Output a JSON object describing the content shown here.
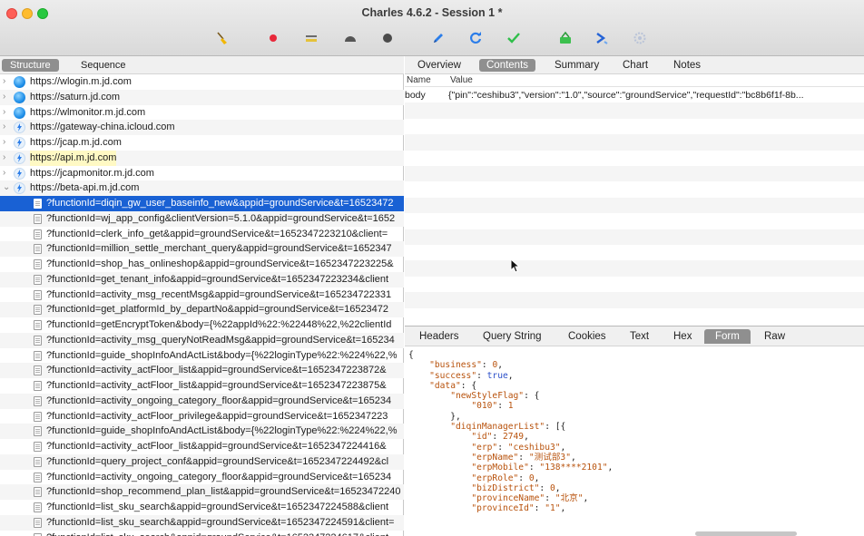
{
  "window": {
    "title": "Charles 4.6.2 - Session 1 *"
  },
  "toolbar": {
    "icons": [
      "broom-icon",
      "record-icon",
      "throttle-icon",
      "breakpoint-icon",
      "stop-icon",
      "pen-icon",
      "refresh-icon",
      "check-icon",
      "basket-icon",
      "tools-icon",
      "settings-icon"
    ]
  },
  "left": {
    "view_tabs": [
      "Structure",
      "Sequence"
    ],
    "hosts": [
      {
        "label": "https://wlogin.m.jd.com",
        "icon": "globe-icon"
      },
      {
        "label": "https://saturn.jd.com",
        "icon": "globe-icon"
      },
      {
        "label": "https://wlmonitor.m.jd.com",
        "icon": "globe-icon"
      },
      {
        "label": "https://gateway-china.icloud.com",
        "icon": "lightning-icon"
      },
      {
        "label": "https://jcap.m.jd.com",
        "icon": "lightning-icon"
      },
      {
        "label": "https://api.m.jd.com",
        "icon": "lightning-icon"
      },
      {
        "label": "https://jcapmonitor.m.jd.com",
        "icon": "lightning-icon"
      },
      {
        "label": "https://beta-api.m.jd.com",
        "icon": "lightning-icon"
      }
    ],
    "requests": [
      "?functionId=diqin_gw_user_baseinfo_new&appid=groundService&t=16523472",
      "?functionId=wj_app_config&clientVersion=5.1.0&appid=groundService&t=1652",
      "?functionId=clerk_info_get&appid=groundService&t=1652347223210&client=",
      "?functionId=million_settle_merchant_query&appid=groundService&t=1652347",
      "?functionId=shop_has_onlineshop&appid=groundService&t=1652347223225&",
      "?functionId=get_tenant_info&appid=groundService&t=1652347223234&client",
      "?functionId=activity_msg_recentMsg&appid=groundService&t=165234722331",
      "?functionId=get_platformId_by_departNo&appid=groundService&t=16523472",
      "?functionId=getEncryptToken&body={%22appId%22:%22448%22,%22clientId",
      "?functionId=activity_msg_queryNotReadMsg&appid=groundService&t=165234",
      "?functionId=guide_shopInfoAndActList&body={%22loginType%22:%224%22,%",
      "?functionId=activity_actFloor_list&appid=groundService&t=1652347223872&",
      "?functionId=activity_actFloor_list&appid=groundService&t=1652347223875&",
      "?functionId=activity_ongoing_category_floor&appid=groundService&t=165234",
      "?functionId=activity_actFloor_privilege&appid=groundService&t=1652347223",
      "?functionId=guide_shopInfoAndActList&body={%22loginType%22:%224%22,%",
      "?functionId=activity_actFloor_list&appid=groundService&t=1652347224416&",
      "?functionId=query_project_conf&appid=groundService&t=1652347224492&cl",
      "?functionId=activity_ongoing_category_floor&appid=groundService&t=165234",
      "?functionId=shop_recommend_plan_list&appid=groundService&t=16523472240",
      "?functionId=list_sku_search&appid=groundService&t=1652347224588&client",
      "?functionId=list_sku_search&appid=groundService&t=1652347224591&client=",
      "?functionId=list_sku_search&appid=groundService&t=1652347224617&client"
    ]
  },
  "right": {
    "top_tabs": [
      "Overview",
      "Contents",
      "Summary",
      "Chart",
      "Notes"
    ],
    "columns": {
      "name": "Name",
      "value": "Value"
    },
    "rows": [
      {
        "name": "body",
        "value": "{\"pin\":\"ceshibu3\",\"version\":\"1.0\",\"source\":\"groundService\",\"requestId\":\"bc8b6f1f-8b..."
      }
    ],
    "bottom_tabs": [
      "Headers",
      "Query String",
      "Cookies",
      "Text",
      "Hex",
      "Form",
      "Raw"
    ],
    "json_lines": [
      "{",
      "    \"business\": 0,",
      "    \"success\": true,",
      "    \"data\": {",
      "        \"newStyleFlag\": {",
      "            \"010\": 1",
      "        },",
      "        \"diqinManagerList\": [{",
      "            \"id\": 2749,",
      "            \"erp\": \"ceshibu3\",",
      "            \"erpName\": \"测试部3\",",
      "            \"erpMobile\": \"138****2101\",",
      "            \"erpRole\": 0,",
      "            \"bizDistrict\": 0,",
      "            \"provinceName\": \"北京\",",
      "            \"provinceId\": \"1\","
    ]
  },
  "colors": {
    "selection": "#1961d4",
    "tab_active": "#8f8f8f",
    "json_key": "#b8520c",
    "json_bool": "#2b4fc9"
  }
}
